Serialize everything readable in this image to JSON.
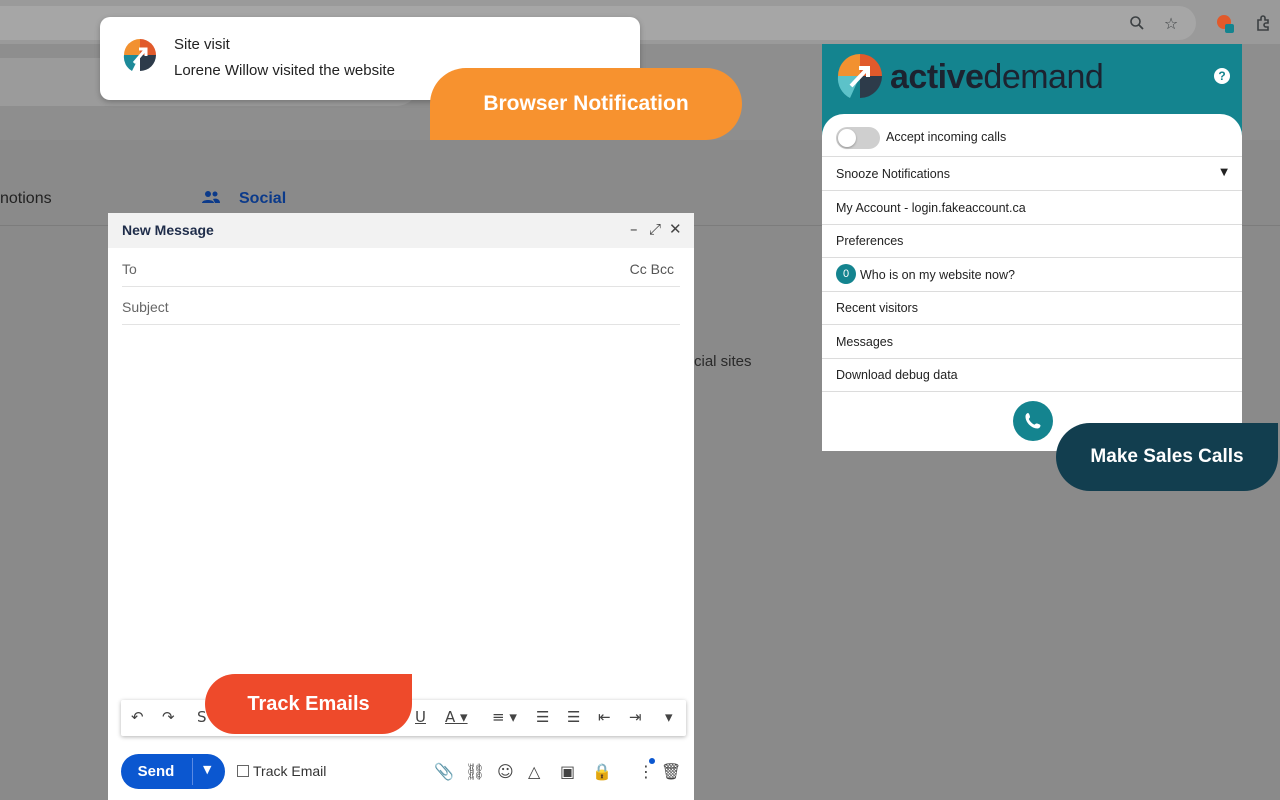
{
  "toast": {
    "title": "Site visit",
    "body": "Lorene Willow visited the website"
  },
  "callouts": {
    "browser_notification": "Browser Notification",
    "track_emails": "Track Emails",
    "make_sales_calls": "Make Sales Calls"
  },
  "background": {
    "tab_promotions": "notions",
    "tab_social": "Social",
    "hint_text": "cial sites"
  },
  "compose": {
    "title": "New Message",
    "to_label": "To",
    "cc_bcc": "Cc Bcc",
    "subject_placeholder": "Subject",
    "send_label": "Send",
    "track_email_label": "Track Email"
  },
  "extension": {
    "brand_bold": "active",
    "brand_light": "demand",
    "help": "?",
    "menu": {
      "accept_calls": "Accept incoming calls",
      "snooze": "Snooze Notifications",
      "account": "My Account - login.fakeaccount.ca",
      "preferences": "Preferences",
      "who_online_count": "0",
      "who_online": "Who is on my website now?",
      "recent_visitors": "Recent visitors",
      "messages": "Messages",
      "debug": "Download debug data"
    },
    "incoming_calls_enabled": false
  },
  "colors": {
    "accent_teal": "#14848f",
    "orange": "#f7922f",
    "red": "#ee4a2b",
    "navy": "#123e4f",
    "gmail_blue": "#0b57d0"
  },
  "icons": [
    "zoom-icon",
    "star-icon",
    "extension-icon",
    "puzzle-icon",
    "undo-icon",
    "redo-icon",
    "underline-icon",
    "text-color-icon",
    "align-icon",
    "numbered-list-icon",
    "bullet-list-icon",
    "indent-less-icon",
    "indent-more-icon",
    "attach-icon",
    "link-icon",
    "emoji-icon",
    "drive-icon",
    "photo-icon",
    "lock-icon",
    "more-icon",
    "trash-icon",
    "phone-icon"
  ]
}
